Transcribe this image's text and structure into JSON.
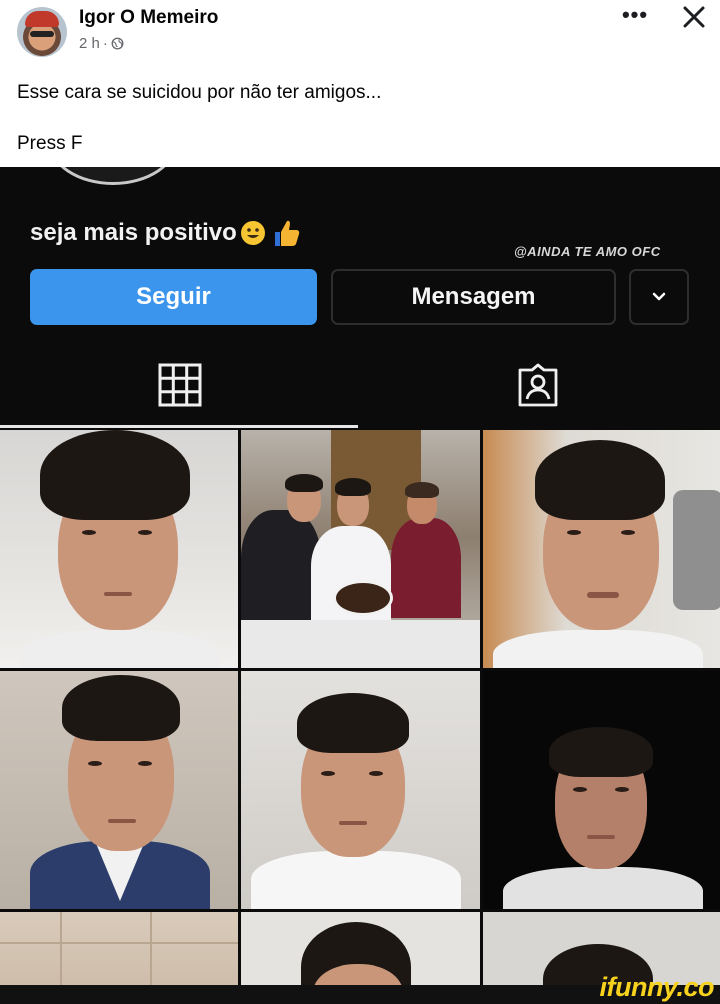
{
  "post": {
    "author": "Igor O Memeiro",
    "time": "2 h",
    "separator": "·",
    "privacy_icon": "globe-icon",
    "menu_icon": "more-horizontal-icon",
    "close_icon": "close-icon",
    "text_line_1": "Esse cara se suicidou por não ter amigos...",
    "text_line_2": "Press F"
  },
  "profile": {
    "bio": "seja mais positivo",
    "bio_emojis": [
      "smiling-face-icon",
      "thumbs-up-icon"
    ],
    "watermark": "@AINDA TE AMO OFC",
    "follow_label": "Seguir",
    "message_label": "Mensagem",
    "more_icon": "chevron-down-icon",
    "tabs": [
      "grid-icon",
      "tagged-person-icon"
    ],
    "active_tab": "grid"
  },
  "photos": [
    {
      "name": "selfie-1"
    },
    {
      "name": "birthday-cake-family"
    },
    {
      "name": "selfie-smiling"
    },
    {
      "name": "selfie-blue-collar"
    },
    {
      "name": "selfie-tiled-wall"
    },
    {
      "name": "selfie-dark"
    },
    {
      "name": "photo-partial-1"
    },
    {
      "name": "photo-partial-2"
    },
    {
      "name": "photo-partial-3"
    }
  ],
  "footer": {
    "brand": "ifunny.co"
  },
  "colors": {
    "follow_button": "#3b95ec",
    "brand_yellow": "#f6d21e",
    "dark_background": "#0b0b0b"
  }
}
